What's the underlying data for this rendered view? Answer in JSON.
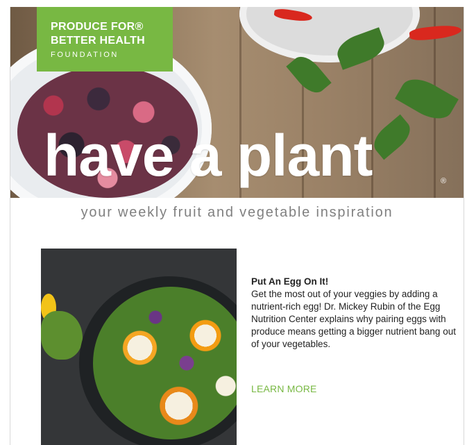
{
  "logo": {
    "line1": "PRODUCE FOR®",
    "line2": "BETTER HEALTH",
    "line3": "FOUNDATION"
  },
  "hero": {
    "headline": "have a plant",
    "mark": "®"
  },
  "tagline": "your weekly fruit and vegetable inspiration",
  "article": {
    "title": "Put An Egg On It!",
    "body": "Get the most out of your veggies by adding a nutrient-rich egg! Dr. Mickey Rubin of the Egg Nutrition Center explains why pairing eggs with produce means getting a bigger nutrient bang out of your vegetables.",
    "cta": "LEARN MORE"
  },
  "colors": {
    "brand_green": "#78b843",
    "tagline_gray": "#808080"
  }
}
